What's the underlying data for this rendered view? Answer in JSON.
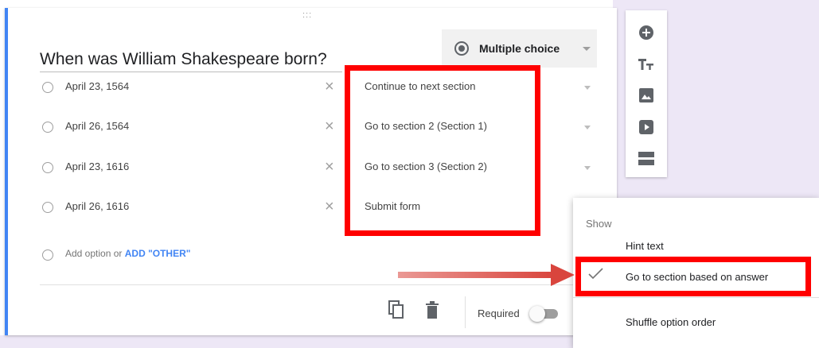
{
  "question": {
    "title": "When was William Shakespeare born?",
    "type_label": "Multiple choice",
    "drag_handle": ":::"
  },
  "options": [
    {
      "label": "April 23, 1564",
      "goto": "Continue to next section"
    },
    {
      "label": "April 26, 1564",
      "goto": "Go to section 2 (Section 1)"
    },
    {
      "label": "April 23, 1616",
      "goto": "Go to section 3 (Section 2)"
    },
    {
      "label": "April 26, 1616",
      "goto": "Submit form"
    }
  ],
  "add_option": {
    "add_label": "Add option",
    "or_label": "or",
    "other_label": "ADD \"OTHER\""
  },
  "footer": {
    "required_label": "Required",
    "required_on": false,
    "icons": [
      "copy-icon",
      "delete-icon"
    ]
  },
  "toolbar": {
    "icons": [
      "add-question-icon",
      "add-title-icon",
      "add-image-icon",
      "add-video-icon",
      "add-section-icon"
    ]
  },
  "menu": {
    "header": "Show",
    "items": [
      {
        "label": "Hint text",
        "checked": false
      },
      {
        "label": "Go to section based on answer",
        "checked": true
      },
      {
        "label": "Shuffle option order",
        "checked": false
      }
    ]
  },
  "colors": {
    "accent": "#4285f4",
    "highlight": "#ff0000",
    "arrow": "#d9453d",
    "page_background": "#ede7f6"
  }
}
